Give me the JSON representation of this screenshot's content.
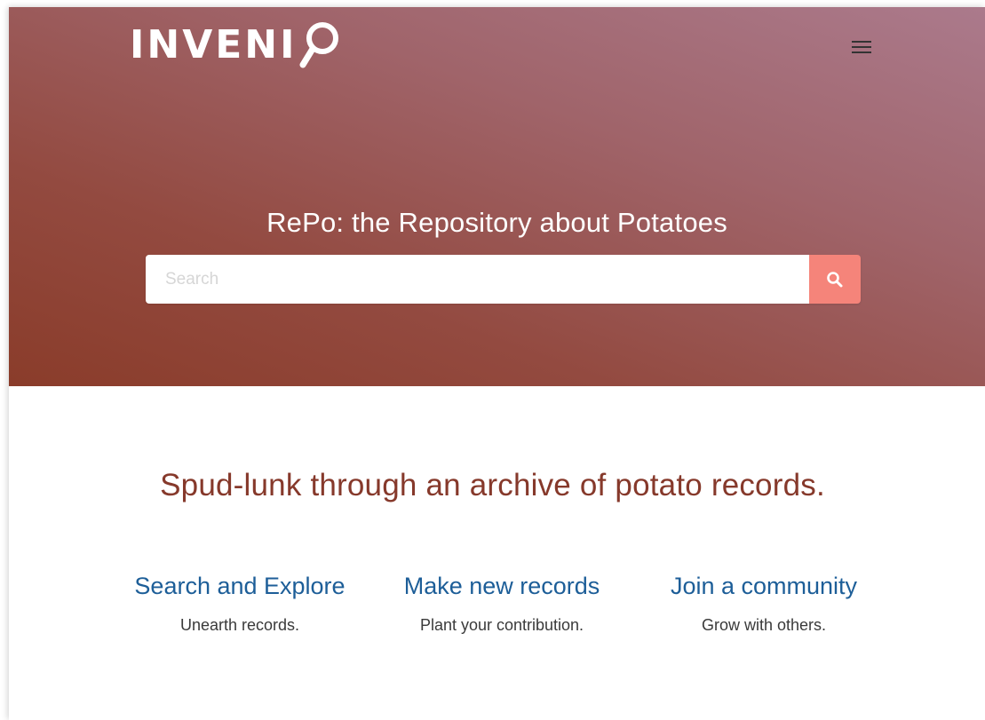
{
  "header": {
    "logo_text": "INVENI",
    "menu_icon": "hamburger-icon"
  },
  "hero": {
    "title": "RePo: the Repository about Potatoes",
    "search": {
      "placeholder": "Search",
      "value": "",
      "button_icon": "search-icon"
    }
  },
  "main": {
    "tagline": "Spud-lunk through an archive of potato records.",
    "features": [
      {
        "title": "Search and Explore",
        "description": "Unearth records."
      },
      {
        "title": "Make new records",
        "description": "Plant your contribution."
      },
      {
        "title": "Join a community",
        "description": "Grow with others."
      }
    ]
  },
  "colors": {
    "hero_top": "#ab7a8c",
    "hero_bottom": "#8a3c2a",
    "search_button": "#f5847a",
    "tagline": "#86392b",
    "link": "#1d5e98"
  }
}
